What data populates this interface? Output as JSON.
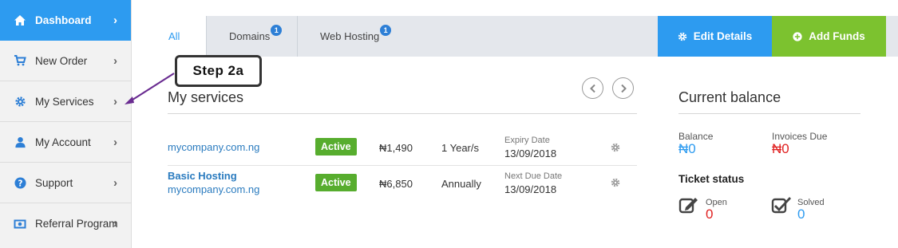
{
  "sidebar": {
    "items": [
      {
        "label": "Dashboard",
        "icon": "home-icon",
        "active": true
      },
      {
        "label": "New Order",
        "icon": "cart-icon"
      },
      {
        "label": "My Services",
        "icon": "gear-icon"
      },
      {
        "label": "My Account",
        "icon": "user-icon"
      },
      {
        "label": "Support",
        "icon": "help-icon"
      },
      {
        "label": "Referral Program",
        "icon": "money-icon"
      }
    ]
  },
  "tabs": [
    {
      "label": "All",
      "badge": null,
      "active": true
    },
    {
      "label": "Domains",
      "badge": "1"
    },
    {
      "label": "Web Hosting",
      "badge": "1"
    }
  ],
  "actions": {
    "edit_details": "Edit Details",
    "add_funds": "Add Funds"
  },
  "annotation": {
    "step": "Step  2a"
  },
  "services": {
    "title": "My services",
    "rows": [
      {
        "name": "mycompany.com.ng",
        "sub": "",
        "status": "Active",
        "price": "₦1,490",
        "cycle": "1 Year/s",
        "date_label": "Expiry Date",
        "date": "13/09/2018"
      },
      {
        "name": "Basic Hosting",
        "sub": "mycompany.com.ng",
        "status": "Active",
        "price": "₦6,850",
        "cycle": "Annually",
        "date_label": "Next Due Date",
        "date": "13/09/2018"
      }
    ]
  },
  "balance": {
    "title": "Current balance",
    "balance_label": "Balance",
    "balance_value": "₦0",
    "invoices_label": "Invoices Due",
    "invoices_value": "₦0",
    "ticket_title": "Ticket status",
    "open_label": "Open",
    "open_value": "0",
    "solved_label": "Solved",
    "solved_value": "0"
  },
  "colors": {
    "accent_blue": "#2d9bf0",
    "add_funds_green": "#7cc22f",
    "status_green": "#57ad2e",
    "due_red": "#e02020",
    "annotation_arrow": "#6a2c91"
  }
}
